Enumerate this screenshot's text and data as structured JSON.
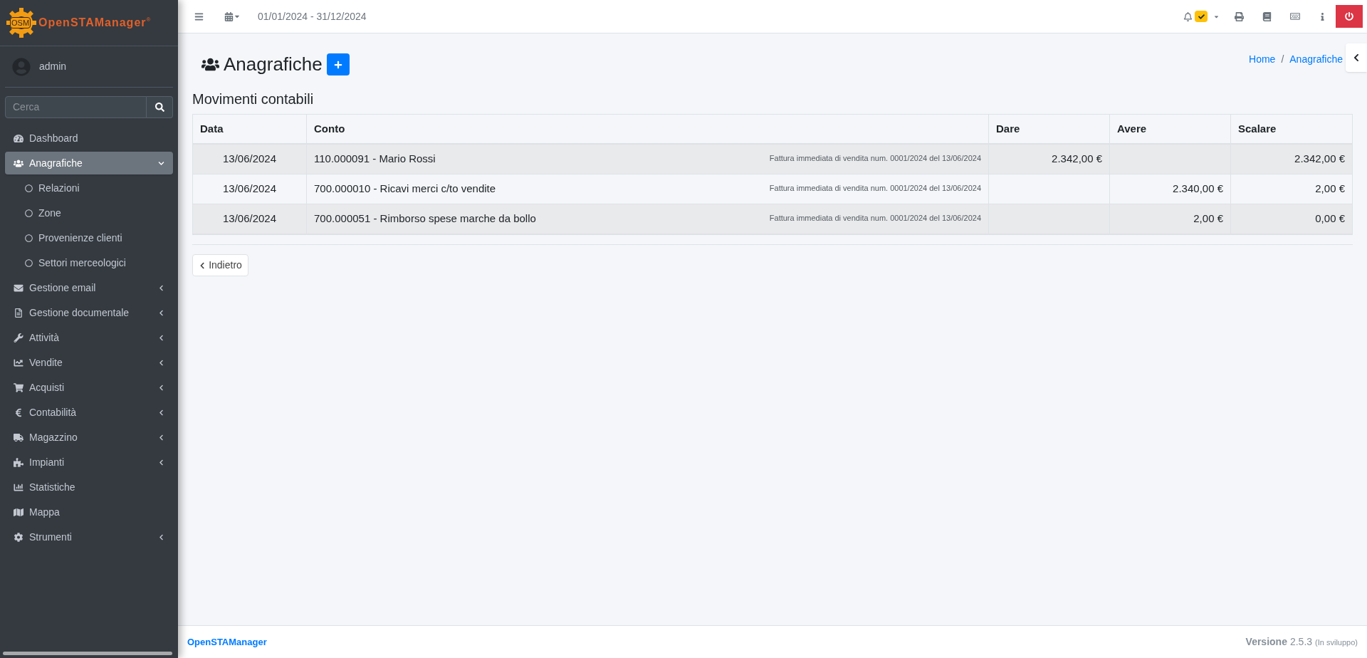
{
  "logo": {
    "badge": "OSM",
    "name": "OpenSTAManager",
    "mark": "®"
  },
  "user": {
    "name": "admin"
  },
  "search": {
    "placeholder": "Cerca"
  },
  "sidebar": {
    "items": [
      {
        "label": "Dashboard",
        "selected": false
      },
      {
        "label": "Anagrafiche",
        "selected": true,
        "expanded": true,
        "children": [
          {
            "label": "Relazioni",
            "selected": false
          },
          {
            "label": "Zone",
            "selected": false
          },
          {
            "label": "Provenienze clienti",
            "selected": false
          },
          {
            "label": "Settori merceologici",
            "selected": false
          }
        ]
      },
      {
        "label": "Gestione email",
        "selected": false,
        "expanded": false
      },
      {
        "label": "Gestione documentale",
        "selected": false,
        "expanded": false
      },
      {
        "label": "Attività",
        "selected": false,
        "expanded": false
      },
      {
        "label": "Vendite",
        "selected": false,
        "expanded": false
      },
      {
        "label": "Acquisti",
        "selected": false,
        "expanded": false
      },
      {
        "label": "Contabilità",
        "selected": false,
        "expanded": false
      },
      {
        "label": "Magazzino",
        "selected": false,
        "expanded": false
      },
      {
        "label": "Impianti",
        "selected": false,
        "expanded": false
      },
      {
        "label": "Statistiche",
        "selected": false
      },
      {
        "label": "Mappa",
        "selected": false
      },
      {
        "label": "Strumenti",
        "selected": false,
        "expanded": false
      }
    ]
  },
  "topbar": {
    "date_range": "01/01/2024 - 31/12/2024"
  },
  "page": {
    "title": "Anagrafiche",
    "breadcrumb": [
      "Home",
      "Anagrafiche"
    ],
    "breadcrumb_separator": "/"
  },
  "section_title": "Movimenti contabili",
  "table": {
    "columns": [
      "Data",
      "Conto",
      "Dare",
      "Avere",
      "Scalare"
    ],
    "rows": [
      {
        "data": "13/06/2024",
        "conto": "110.000091 - Mario Rossi",
        "note": "Fattura immediata di vendita num. 0001/2024 del 13/06/2024",
        "dare": "2.342,00 €",
        "scalare": "2.342,00 €"
      },
      {
        "data": "13/06/2024",
        "conto": "700.000010 - Ricavi merci c/to vendite",
        "note": "Fattura immediata di vendita num. 0001/2024 del 13/06/2024",
        "avere": "2.340,00 €",
        "scalare": "2,00 €"
      },
      {
        "data": "13/06/2024",
        "conto": "700.000051 - Rimborso spese marche da bollo",
        "note": "Fattura immediata di vendita num. 0001/2024 del 13/06/2024",
        "avere": "2,00 €",
        "scalare": "0,00 €"
      }
    ]
  },
  "back_button": "Indietro",
  "footer": {
    "brand": "OpenSTAManager",
    "version_label": "Versione",
    "version": "2.5.3",
    "status": "(In sviluppo)"
  }
}
